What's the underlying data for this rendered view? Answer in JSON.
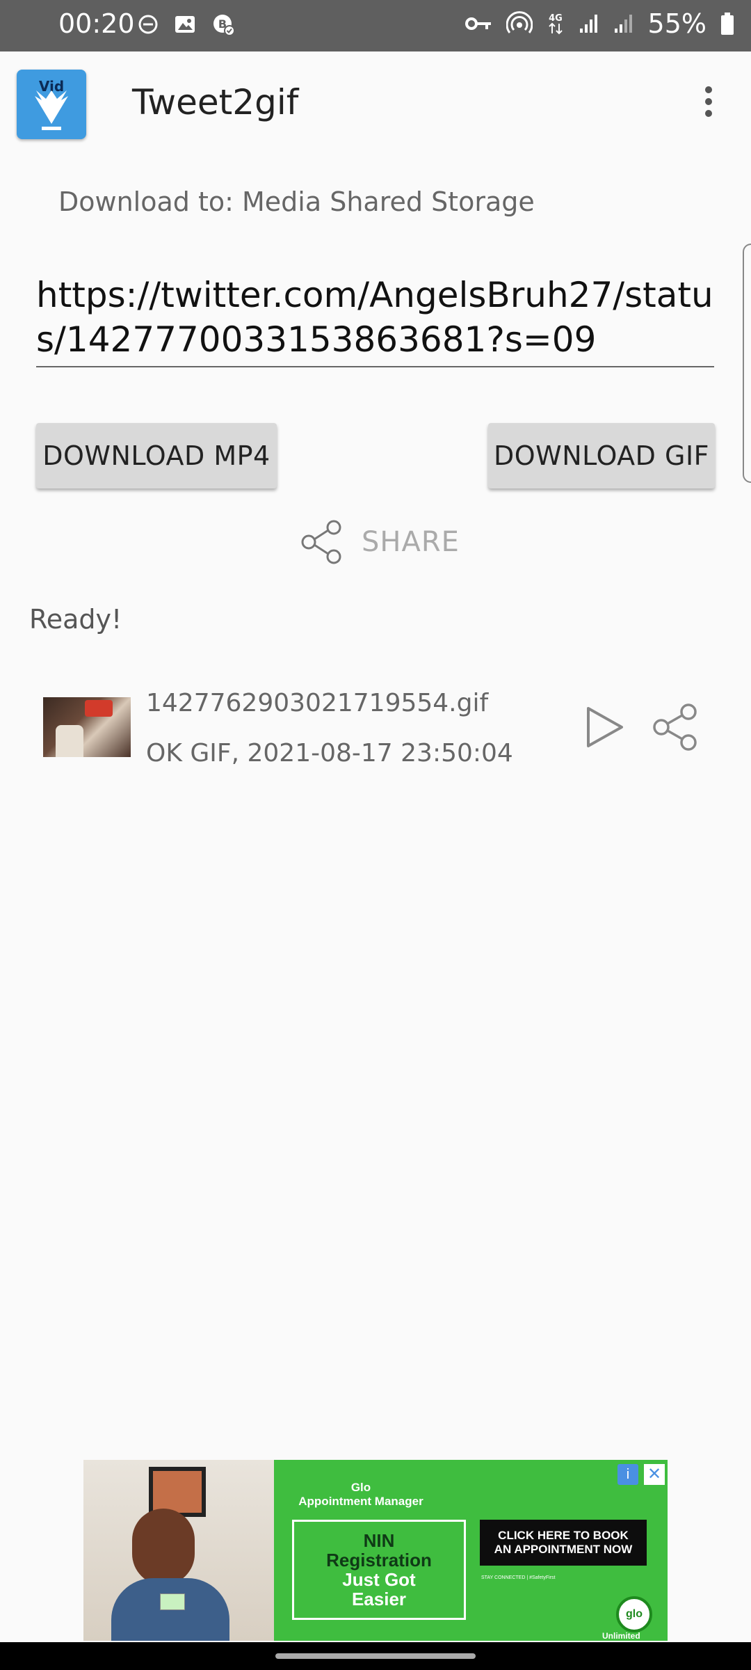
{
  "status_bar": {
    "time": "00:20",
    "battery": "55%",
    "icons_left": [
      "do-not-disturb-icon",
      "gallery-icon",
      "whatsapp-business-icon"
    ],
    "icons_right": [
      "vpn-key-icon",
      "hotspot-icon",
      "4g-data-icon",
      "signal-icon",
      "signal-icon",
      "battery-icon"
    ]
  },
  "app_bar": {
    "logo_text": "Vid",
    "title": "Tweet2gif"
  },
  "download_to": "Download to: Media Shared Storage",
  "url_input": {
    "value": "https://twitter.com/AngelsBruh27/status/1427770033153863681?s=09"
  },
  "buttons": {
    "download_mp4": "DOWNLOAD MP4",
    "download_gif": "DOWNLOAD GIF"
  },
  "share_label": "SHARE",
  "status_text": "Ready!",
  "files": [
    {
      "name": "1427762903021719554.gif",
      "meta": "OK GIF, 2021-08-17 23:50:04"
    }
  ],
  "ad": {
    "brand_line1": "Glo",
    "brand_line2": "Appointment Manager",
    "box_line1": "NIN",
    "box_line2": "Registration",
    "box_line3": "Just Got",
    "box_line4": "Easier",
    "cta_line1": "CLICK HERE TO BOOK",
    "cta_line2": "AN APPOINTMENT NOW",
    "sub": "STAY CONNECTED | #SafetyFirst",
    "logo_text": "Unlimited",
    "logo_mark": "glo",
    "info_glyph": "i",
    "close_glyph": "✕"
  },
  "colors": {
    "status_bar_bg": "#5f5f5f",
    "app_bg": "#fafafa",
    "logo_blue": "#3f9be0",
    "button_bg": "#d9d9d9",
    "ad_green": "#3fbd3f"
  }
}
